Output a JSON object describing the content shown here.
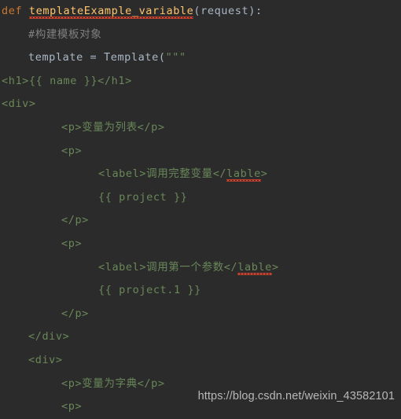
{
  "editor": {
    "theme": "darcula",
    "language": "python",
    "background_color": "#2b2b2b",
    "colors": {
      "keyword": "#cc7832",
      "function_name": "#ffc66d",
      "default_text": "#a9b7c6",
      "comment": "#808080",
      "string": "#6a8759",
      "error_underline": "#e8442d"
    }
  },
  "watermark": {
    "text": "https://blog.csdn.net/weixin_43582101"
  },
  "code": {
    "lines": [
      {
        "indent": 0,
        "tokens": [
          {
            "text": "def ",
            "type": "keyword"
          },
          {
            "text": "templateExample_variable",
            "type": "funcname",
            "error": true
          },
          {
            "text": "(request):",
            "type": "default"
          }
        ]
      },
      {
        "indent": 1,
        "tokens": [
          {
            "text": "#构建模板对象",
            "type": "comment"
          }
        ]
      },
      {
        "indent": 1,
        "tokens": [
          {
            "text": "template = Template(",
            "type": "default"
          },
          {
            "text": "\"\"\"",
            "type": "string"
          }
        ]
      },
      {
        "indent": 0,
        "tokens": [
          {
            "text": "<h1>{{ name }}</h1>",
            "type": "string"
          }
        ]
      },
      {
        "indent": 0,
        "tokens": [
          {
            "text": "<div>",
            "type": "string"
          }
        ]
      },
      {
        "indent": 2,
        "tokens": [
          {
            "text": "<p>变量为列表</p>",
            "type": "string"
          }
        ]
      },
      {
        "indent": 2,
        "tokens": [
          {
            "text": "<p>",
            "type": "string"
          }
        ]
      },
      {
        "indent": 3,
        "tokens": [
          {
            "text": "<label>调用完整变量</",
            "type": "string"
          },
          {
            "text": "lable",
            "type": "string",
            "error": true
          },
          {
            "text": ">",
            "type": "string"
          }
        ]
      },
      {
        "indent": 3,
        "tokens": [
          {
            "text": "{{ project }}",
            "type": "string"
          }
        ]
      },
      {
        "indent": 2,
        "tokens": [
          {
            "text": "</p>",
            "type": "string"
          }
        ]
      },
      {
        "indent": 2,
        "tokens": [
          {
            "text": "<p>",
            "type": "string"
          }
        ]
      },
      {
        "indent": 3,
        "tokens": [
          {
            "text": "<label>调用第一个参数</",
            "type": "string"
          },
          {
            "text": "lable",
            "type": "string",
            "error": true
          },
          {
            "text": ">",
            "type": "string"
          }
        ]
      },
      {
        "indent": 3,
        "tokens": [
          {
            "text": "{{ project.1 }}",
            "type": "string"
          }
        ]
      },
      {
        "indent": 2,
        "tokens": [
          {
            "text": "</p>",
            "type": "string"
          }
        ]
      },
      {
        "indent": 1,
        "tokens": [
          {
            "text": "</div>",
            "type": "string"
          }
        ]
      },
      {
        "indent": 1,
        "tokens": [
          {
            "text": "<div>",
            "type": "string"
          }
        ]
      },
      {
        "indent": 2,
        "tokens": [
          {
            "text": "<p>变量为字典</p>",
            "type": "string"
          }
        ]
      },
      {
        "indent": 2,
        "tokens": [
          {
            "text": "<p>",
            "type": "string"
          }
        ]
      }
    ]
  }
}
